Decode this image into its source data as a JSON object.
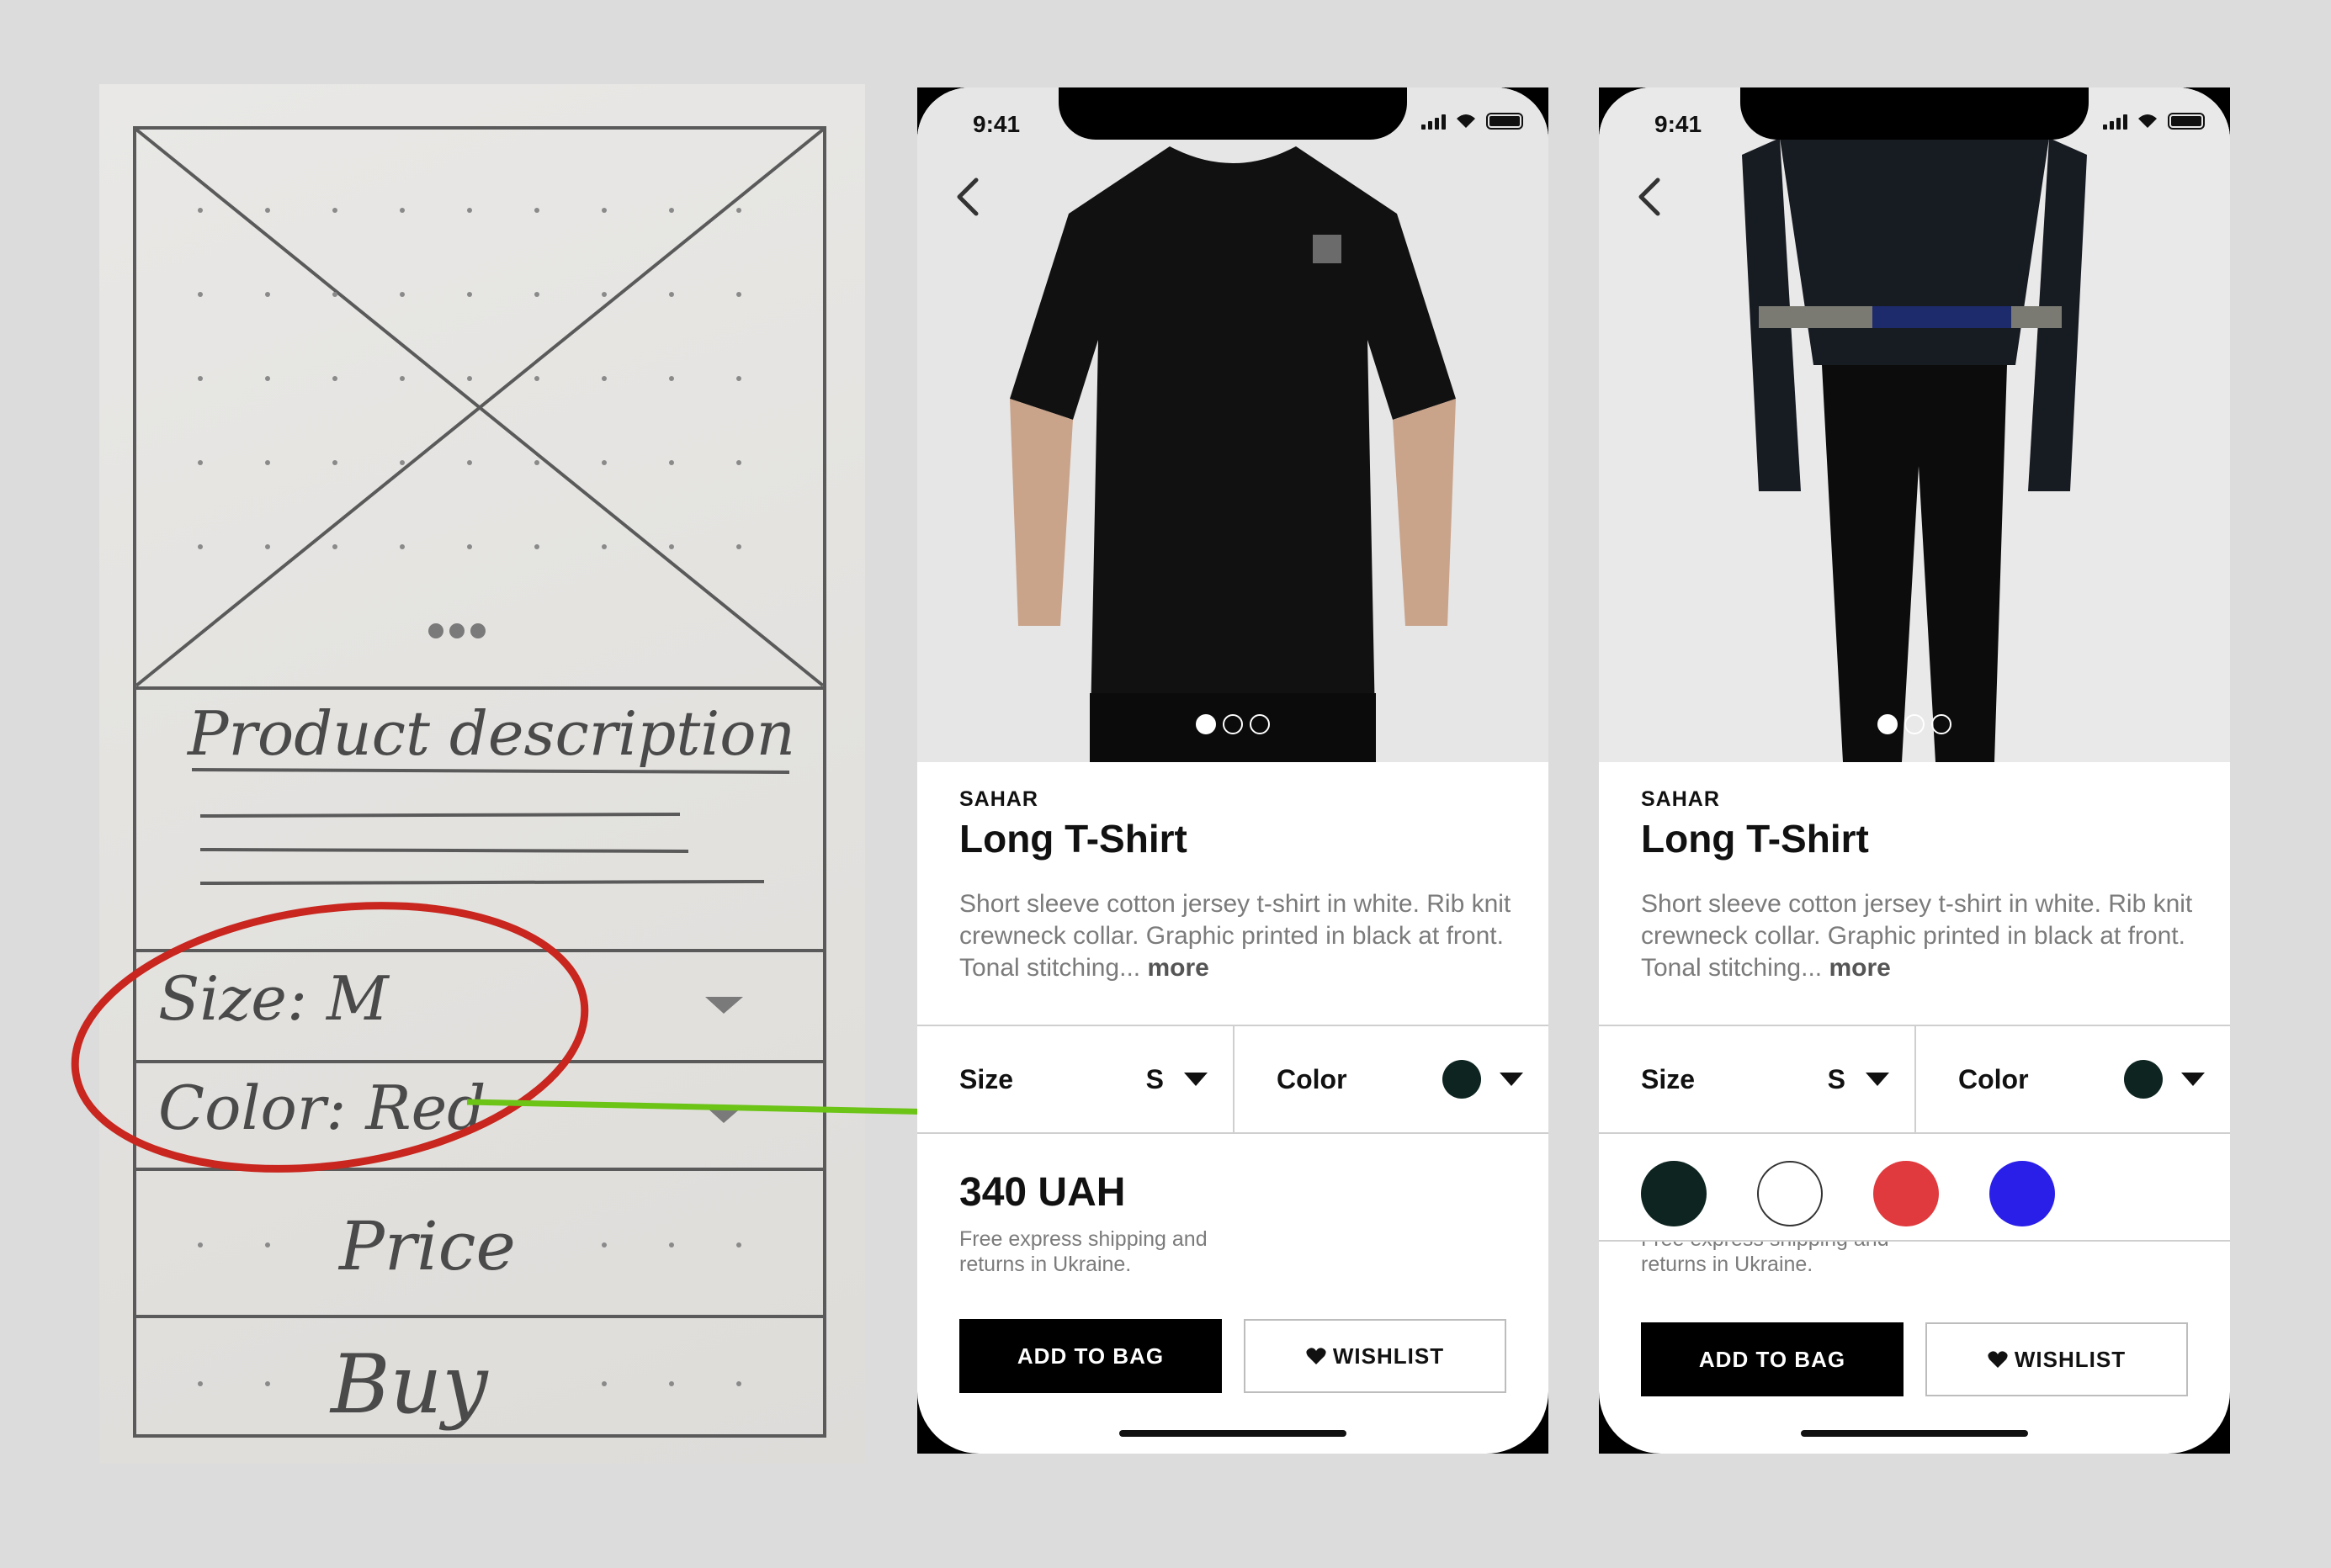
{
  "sketch": {
    "description_label": "Product description",
    "size_label": "Size: M",
    "color_label": "Color: Red",
    "price_label": "Price",
    "buy_label": "Buy"
  },
  "status_bar": {
    "time": "9:41"
  },
  "product": {
    "brand": "SAHAR",
    "title": "Long T-Shirt",
    "description": "Short sleeve cotton jersey t-shirt in white. Rib knit crewneck collar. Graphic printed in black at front. Tonal stitching...",
    "more_label": "more",
    "price": "340 UAH",
    "shipping": "Free express shipping and returns in Ukraine."
  },
  "selectors": {
    "size_label": "Size",
    "size_value": "S",
    "color_label": "Color",
    "selected_color": "#0d2421"
  },
  "gallery": {
    "pages": 3,
    "active_page": 1
  },
  "swatches": [
    "#0d2421",
    "#ffffff",
    "#e03a3e",
    "#2a1fe8"
  ],
  "buttons": {
    "add_to_bag": "ADD TO BAG",
    "wishlist": "WISHLIST"
  },
  "icons": {
    "back": "chevron-left-icon",
    "wishlist": "heart-icon",
    "dropdown": "caret-down-icon"
  },
  "colors": {
    "annotation_circle": "#c8261e",
    "arrow": "#6cc417"
  }
}
